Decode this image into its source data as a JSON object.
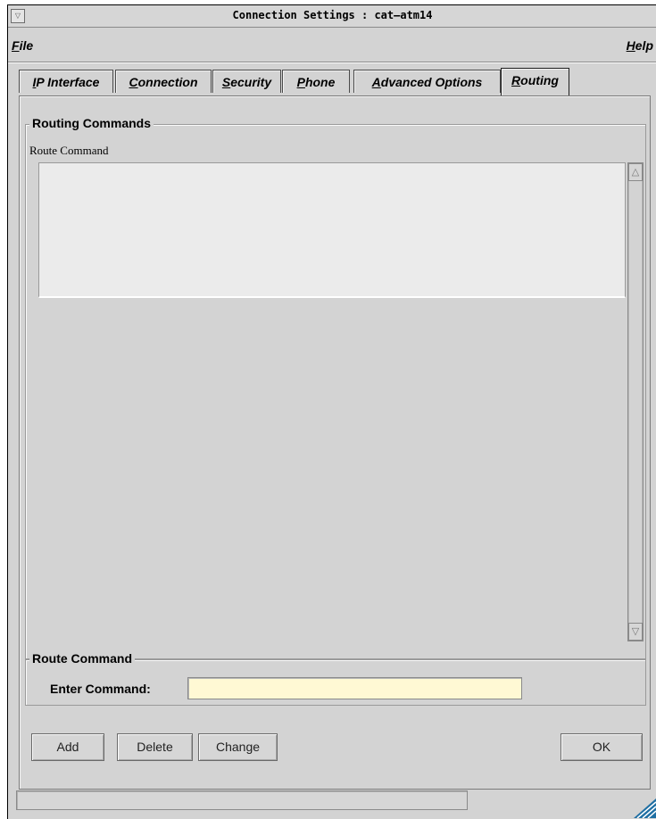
{
  "window": {
    "title": "Connection Settings : cat–atm14",
    "menu_glyph": "▽"
  },
  "menubar": {
    "file_label": "File",
    "help_label": "Help"
  },
  "tabs": [
    {
      "label": "IP Interface",
      "active": false
    },
    {
      "label": "Connection",
      "active": false
    },
    {
      "label": "Security",
      "active": false
    },
    {
      "label": "Phone",
      "active": false
    },
    {
      "label": "Advanced Options",
      "active": false
    },
    {
      "label": "Routing",
      "active": true
    }
  ],
  "routing": {
    "group_title": "Routing Commands",
    "column_header": "Route Command",
    "rows": []
  },
  "route_command": {
    "group_title": "Route Command",
    "field_label": "Enter Command:",
    "value": "",
    "placeholder": ""
  },
  "buttons": {
    "add": "Add",
    "delete": "Delete",
    "change": "Change",
    "ok": "OK"
  },
  "statusbar": {
    "text": ""
  },
  "icons": {
    "window_menu": "window-menu-icon",
    "scroll_up": "scroll-up-arrow-icon",
    "scroll_down": "scroll-down-arrow-icon",
    "corner_logo": "corner-logo-icon"
  },
  "colors": {
    "background": "#d3d3d3",
    "input_background": "#fff9d4",
    "list_background": "#ebebeb",
    "logo": "#1f6fa3"
  }
}
